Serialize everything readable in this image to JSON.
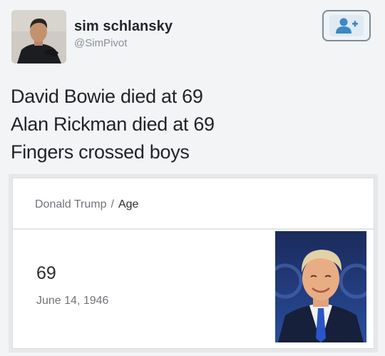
{
  "tweet": {
    "author_name": "sim schlansky",
    "author_handle": "@SimPivot",
    "lines": [
      "David Bowie died at 69",
      "Alan Rickman died at 69",
      "Fingers crossed boys"
    ]
  },
  "card": {
    "breadcrumb": {
      "entity": "Donald Trump",
      "separator": "/",
      "attribute": "Age"
    },
    "value": "69",
    "subtext": "June 14, 1946"
  },
  "icons": {
    "follow": "add-user-icon"
  },
  "colors": {
    "follow_icon": "#3b88c3",
    "follow_border": "#7a8c99"
  }
}
